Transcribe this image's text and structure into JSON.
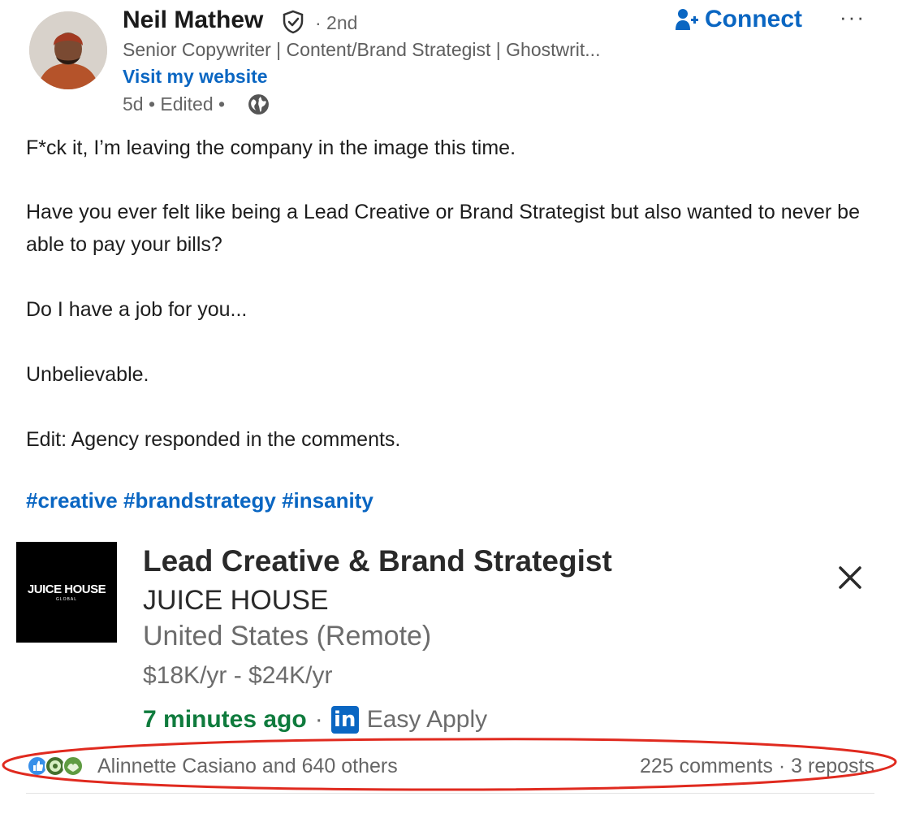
{
  "author": {
    "name": "Neil Mathew",
    "degree": "· 2nd",
    "headline": "Senior Copywriter | Content/Brand Strategist | Ghostwrit...",
    "website_link": "Visit my website",
    "meta": "5d • Edited •",
    "verified_icon": "shield-check-icon",
    "visibility_icon": "globe-icon"
  },
  "actions": {
    "connect_label": "Connect",
    "connect_icon": "add-person-icon",
    "more_label": "···"
  },
  "post": {
    "paragraphs": [
      "F*ck it, I’m leaving the company in the image this time.",
      "Have you ever felt like being a Lead Creative or Brand Strategist but also wanted to never be able to pay your bills?",
      "Do I have a job for you...",
      "Unbelievable.",
      "Edit: Agency responded in the comments."
    ],
    "hashtags": [
      "#creative",
      "#brandstrategy",
      "#insanity"
    ]
  },
  "job_card": {
    "logo_text": "JUICE HOUSE",
    "logo_subtext": "GLOBAL",
    "title": "Lead Creative & Brand Strategist",
    "company": "JUICE HOUSE",
    "location": "United States (Remote)",
    "salary": "$18K/yr - $24K/yr",
    "posted": "7 minutes ago",
    "separator": "·",
    "apply_icon_text": "in",
    "apply_label": "Easy Apply"
  },
  "social": {
    "reactions_text": "Alinnette Casiano and 640 others",
    "comments": "225 comments",
    "separator": "·",
    "reposts": "3 reposts"
  },
  "colors": {
    "link_blue": "#0a66c2",
    "posted_green": "#0f7b3d",
    "annotation_red": "#e02a1f"
  }
}
